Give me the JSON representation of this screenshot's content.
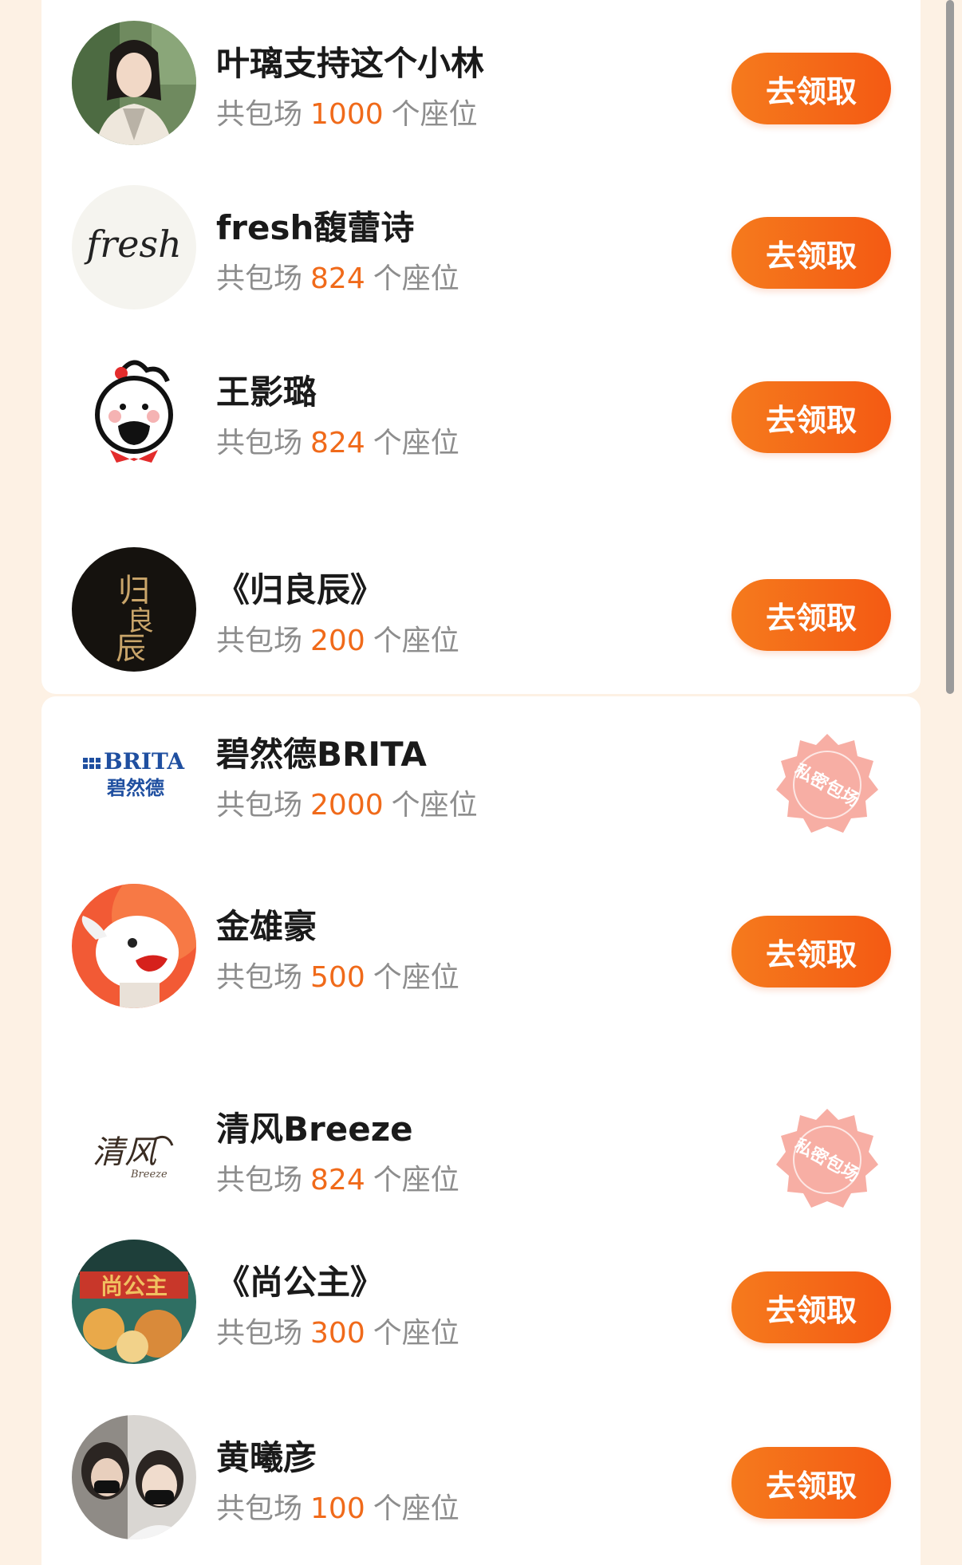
{
  "list": {
    "prefix": "共包场",
    "suffix": "个座位",
    "claim_label": "去领取",
    "stamp_label": "私密包场",
    "accent_color": "#f06a1a",
    "items": [
      {
        "name": "叶璃支持这个小林",
        "seats": "1000",
        "avatar": "portrait-photo",
        "action": "claim"
      },
      {
        "name": "fresh馥蕾诗",
        "seats": "824",
        "avatar": "fresh-logo",
        "logo_text": "fresh",
        "action": "claim"
      },
      {
        "name": "王影璐",
        "seats": "824",
        "avatar": "cartoon-face",
        "action": "claim"
      },
      {
        "name": "《归良辰》",
        "seats": "200",
        "avatar": "calligraphy-poster",
        "logo_text": "归良辰",
        "action": "claim"
      },
      {
        "name": "碧然德BRITA",
        "seats": "2000",
        "avatar": "brita-logo",
        "logo_text": "BRITA",
        "logo_sub": "碧然德",
        "action": "private"
      },
      {
        "name": "金雄豪",
        "seats": "500",
        "avatar": "red-cartoon",
        "action": "claim"
      },
      {
        "name": "清风Breeze",
        "seats": "824",
        "avatar": "breeze-logo",
        "logo_text": "清风",
        "logo_sub": "Breeze",
        "action": "private"
      },
      {
        "name": "《尚公主》",
        "seats": "300",
        "avatar": "drama-poster",
        "logo_text": "尚公主",
        "action": "claim"
      },
      {
        "name": "黄曦彦",
        "seats": "100",
        "avatar": "masked-portrait",
        "action": "claim"
      }
    ]
  }
}
